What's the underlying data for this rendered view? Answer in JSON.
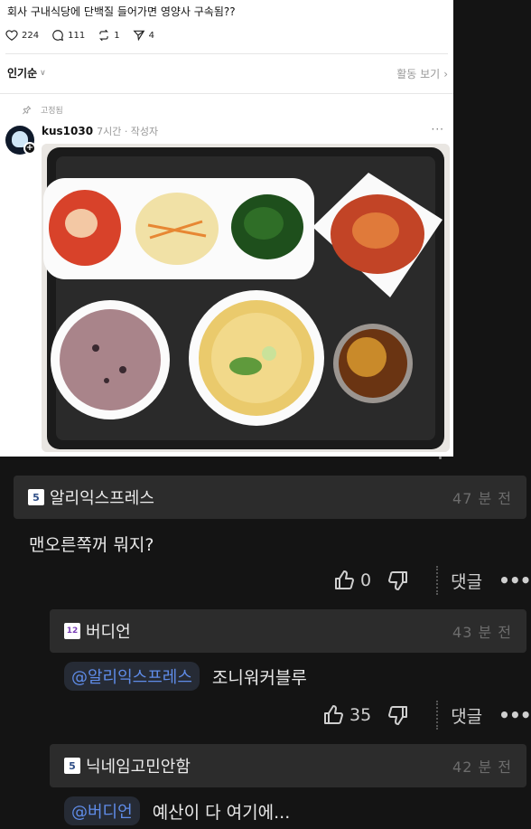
{
  "post": {
    "title": "회사 구내식당에 단백질 들어가면 영양사 구속됨??",
    "stats": [
      {
        "icon": "heart-icon",
        "value": "224"
      },
      {
        "icon": "comment-icon",
        "value": "111"
      },
      {
        "icon": "repost-icon",
        "value": "1"
      },
      {
        "icon": "share-icon",
        "value": "4"
      }
    ],
    "sort_label": "인기순",
    "activity_label": "활동 보기",
    "pinned_label": "고정됨",
    "author": "kus1030",
    "author_meta": "7시간 · 작성자",
    "more": "···"
  },
  "comments": [
    {
      "badge": "5",
      "nick": "알리익스프레스",
      "time": "47 분 전",
      "mention": "",
      "text": "맨오른쪽꺼 뭐지?",
      "likes": "0",
      "reply_label": "댓글",
      "more": "•••"
    },
    {
      "badge": "12",
      "nick": "버디언",
      "time": "43 분 전",
      "mention": "@알리익스프레스",
      "text": "조니워커블루",
      "likes": "35",
      "reply_label": "댓글",
      "more": "•••"
    },
    {
      "badge": "5",
      "nick": "닉네임고민안함",
      "time": "42 분 전",
      "mention": "@버디언",
      "text": "예산이 다 여기에..."
    }
  ],
  "colors": {
    "page_bg": "#141414",
    "comment_header_bg": "#2c2c2c",
    "mention_text": "#5f8ce8",
    "muted_text": "#6c6c6c"
  }
}
